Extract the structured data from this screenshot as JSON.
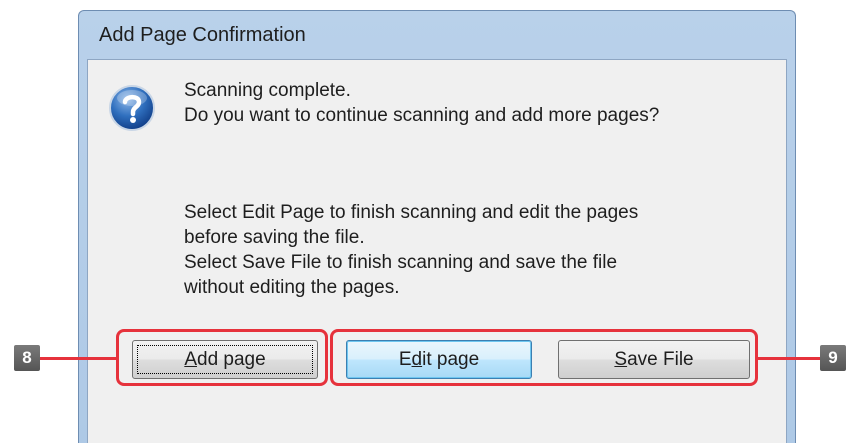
{
  "dialog": {
    "title": "Add Page Confirmation",
    "icon": "question-icon",
    "message": {
      "line1": "Scanning complete.",
      "line2": "Do you want to continue scanning and add more pages?"
    },
    "instructions": {
      "line1": "Select Edit Page to finish scanning and edit the pages",
      "line2": "before saving the file.",
      "line3": "Select Save File to finish scanning and save the file",
      "line4": "without editing the pages."
    },
    "buttons": {
      "add_page": {
        "mnemonic": "A",
        "rest": "dd page",
        "label": "Add page"
      },
      "edit_page": {
        "pre": "E",
        "mnemonic": "d",
        "rest": "it page",
        "label": "Edit page"
      },
      "save_file": {
        "mnemonic": "S",
        "rest": "ave File",
        "label": "Save File"
      }
    }
  },
  "callouts": {
    "left_number": "8",
    "right_number": "9",
    "color": "#e6323c"
  }
}
